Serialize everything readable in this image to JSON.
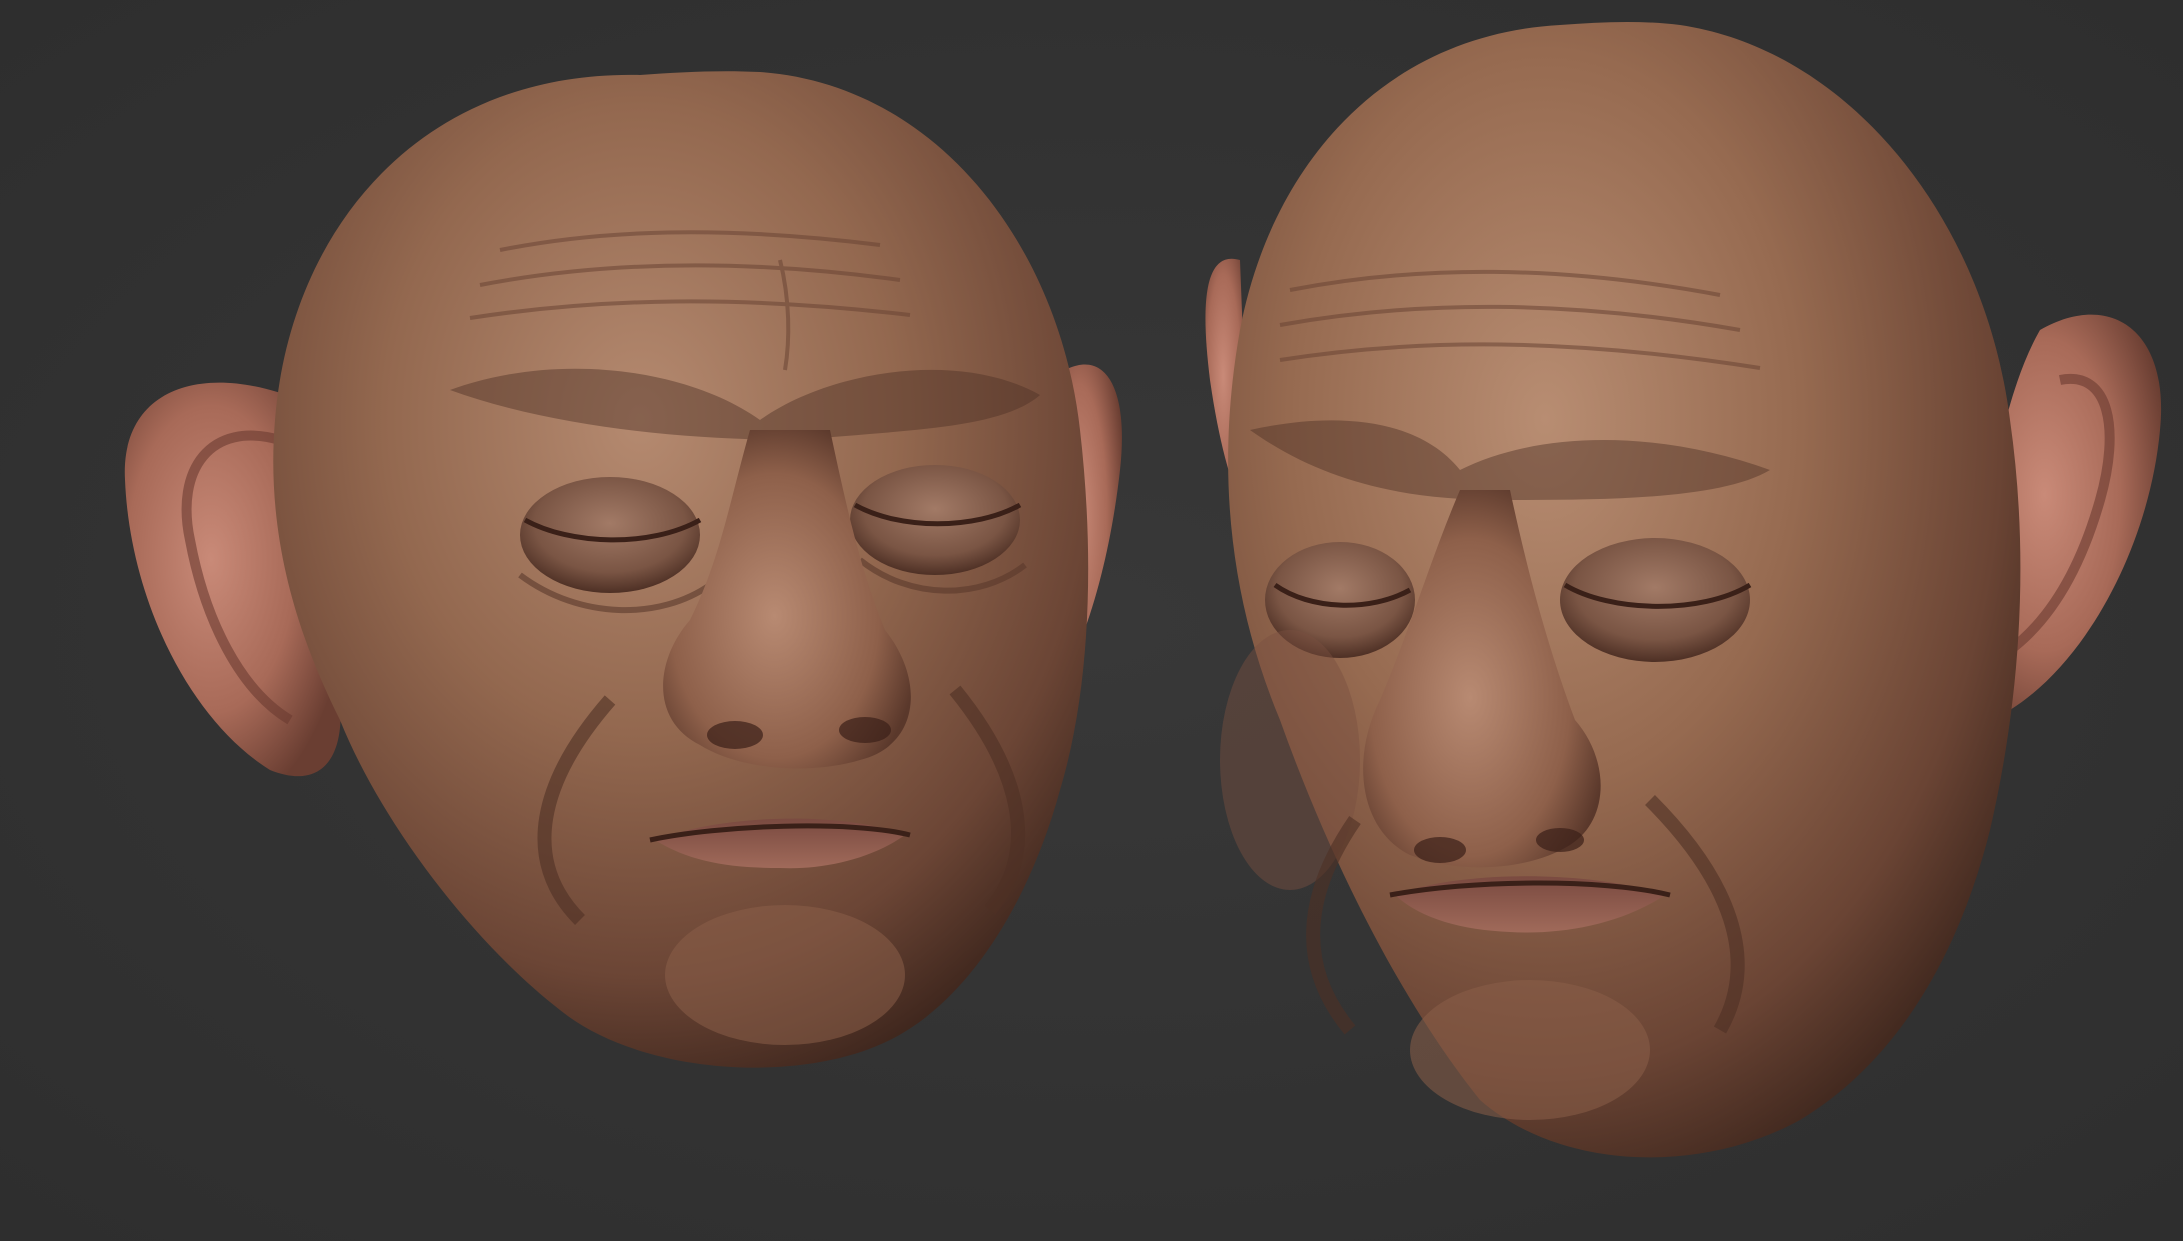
{
  "scene": {
    "background_color": "#333333",
    "skin_base_color": "#9a6e55",
    "skin_shadow_color": "#4a2e22",
    "ear_color": "#b07565"
  },
  "subjects": [
    {
      "name": "head-front-view",
      "view": "front",
      "eyes": "closed"
    },
    {
      "name": "head-three-quarter-view",
      "view": "three-quarter",
      "eyes": "closed"
    }
  ]
}
